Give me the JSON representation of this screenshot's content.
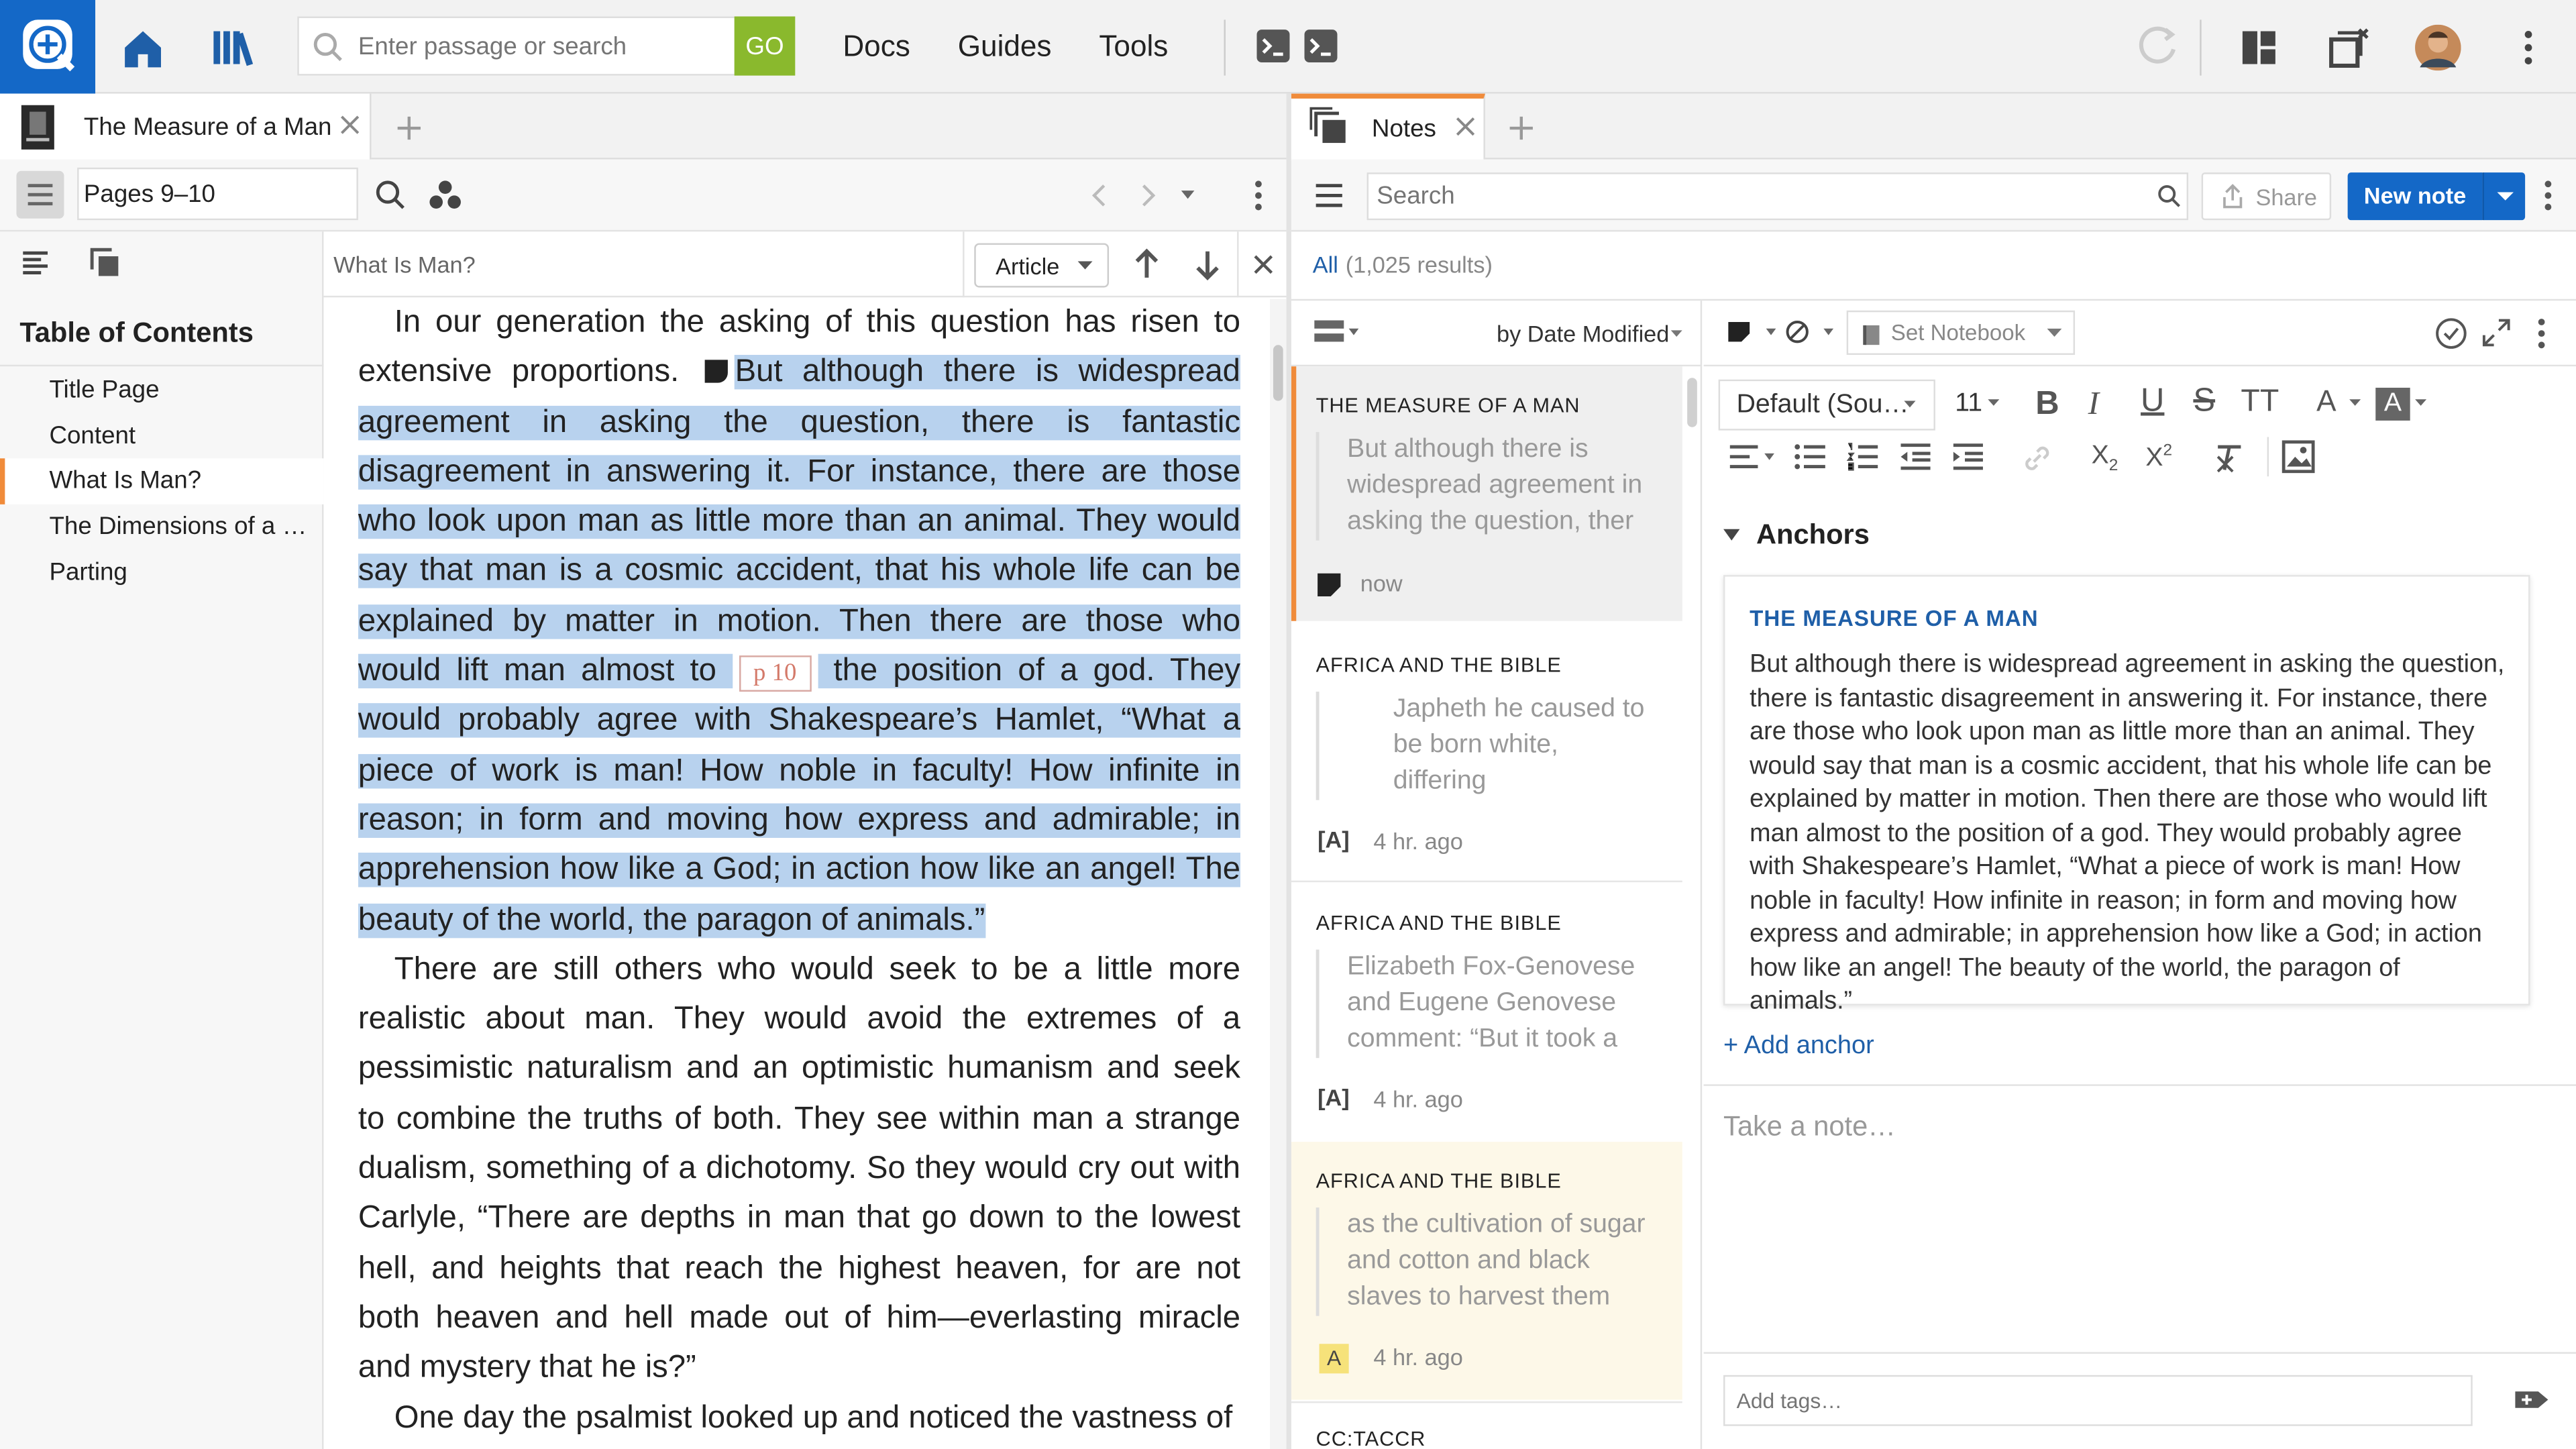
{
  "topbar": {
    "search_placeholder": "Enter passage or search",
    "go_label": "GO",
    "nav": [
      "Docs",
      "Guides",
      "Tools"
    ]
  },
  "left_panel": {
    "tab_title": "The Measure of a Man",
    "pages_value": "Pages 9–10",
    "find_value": "What Is Man?",
    "article_label": "Article",
    "toc_heading": "Table of Contents",
    "toc_items": [
      "Title Page",
      "Content",
      "What Is Man?",
      "The Dimensions of a C…",
      "Parting"
    ],
    "toc_active_index": 2,
    "reader": {
      "p1_before": "In our generation the asking of this question has risen to extensive proportions. ",
      "p1_hl_a": "But although there is widespread agreement in asking the question, there is fantastic disagreement in answering it. For instance, there are those who look upon man as little more than an animal. They would say that man is a cosmic accident, that his whole life can be explained by matter in motion. Then there are those who would lift man almost to ",
      "page_marker": "p 10",
      "p1_hl_b": " the position of a god. They would probably agree with Shakespeare’s Hamlet, “What a piece of work is man! How noble in faculty! How infinite in reason; in form and moving how express and admirable; in apprehension how like a God; in action how like an angel! The beauty of the world, the paragon of animals.”",
      "p2": "There are still others who would seek to be a little more realistic about man. They would avoid the extremes of a pessimistic naturalism and an optimistic humanism and seek to combine the truths of both. They see within man a strange dualism, something of a dichotomy. So they would cry out with Carlyle, “There are depths in man that go down to the lowest hell, and heights that reach the highest heaven, for are not both heaven and hell made out of him—everlasting miracle and mystery that he is?”",
      "p3": "One day the psalmist looked up and noticed the vastness of"
    }
  },
  "right_panel": {
    "tab_title": "Notes",
    "search_placeholder": "Search",
    "share_label": "Share",
    "new_note_label": "New note",
    "results_all": "All",
    "results_count": "(1,025 results)",
    "sort_label": "by Date Modified",
    "notes": [
      {
        "title": "THE MEASURE OF A MAN",
        "text": "But although there is widespread agreement in asking the question, ther",
        "time": "now",
        "icon": "note-marker-icon"
      },
      {
        "title": "AFRICA AND THE BIBLE",
        "text": "Japheth he caused to be born white, differing",
        "time": "4 hr. ago",
        "icon": "bracket-a-icon"
      },
      {
        "title": "AFRICA AND THE BIBLE",
        "text": "Elizabeth Fox-Genovese and Eugene Genovese comment: “But it took a",
        "time": "4 hr. ago",
        "icon": "bracket-a-icon"
      },
      {
        "title": "AFRICA AND THE BIBLE",
        "text": "as the cultivation of sugar and cotton and black slaves to harvest them",
        "time": "4 hr. ago",
        "icon": "highlight-a-icon"
      },
      {
        "title": "CC:TACCR",
        "text": "",
        "time": "",
        "icon": ""
      }
    ],
    "editor": {
      "set_notebook_label": "Set Notebook",
      "font_family_label": "Default (Sou…",
      "font_size_label": "11",
      "anchors_label": "Anchors",
      "anchor_title": "THE MEASURE OF A MAN",
      "anchor_text": "But although there is widespread agreement in asking the question, there is fantastic disagreement in answering it. For instance, there are those who look upon man as little more than an animal. They would say that man is a cosmic accident, that his whole life can be explained by matter in motion. Then there are those who would lift man almost to the position of a god. They would probably agree with Shakespeare’s Hamlet, “What a piece of work is man! How noble in faculty! How infinite in reason; in form and moving how express and admirable; in apprehension how like a God; in action how like an angel! The beauty of the world, the paragon of animals.”",
      "add_anchor_label": "+ Add anchor",
      "take_note_placeholder": "Take a note…",
      "tags_placeholder": "Add tags…"
    }
  },
  "colors": {
    "brand_blue": "#1468c7",
    "go_green": "#8ab92d",
    "highlight": "#b8d2ee",
    "active_tab_accent": "#f08b3a",
    "link_blue": "#1f5fa8",
    "yellow_note_bg": "#fdf8e8",
    "selected_note_bg": "#efefef"
  }
}
